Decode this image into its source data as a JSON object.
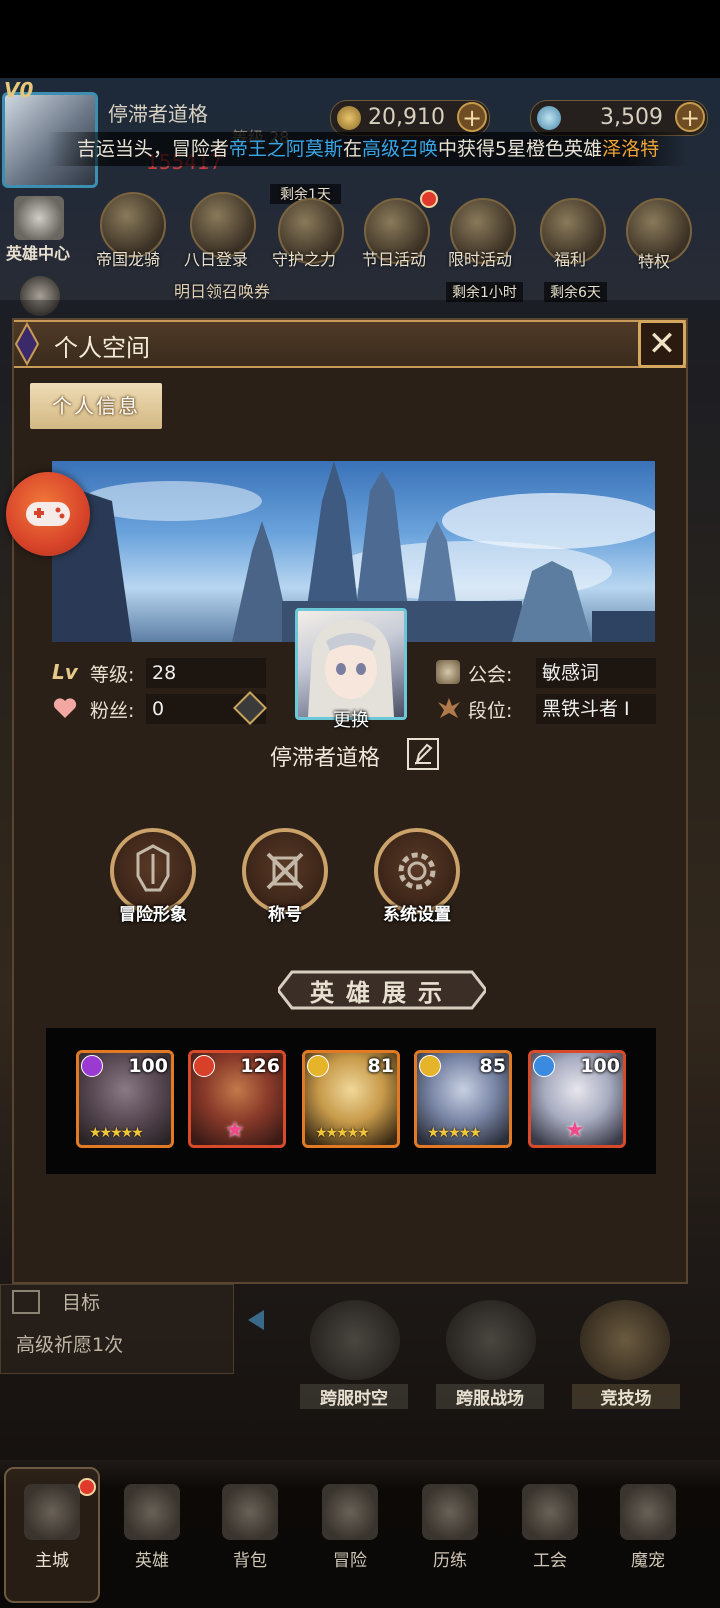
{
  "top_bar": {
    "vip_label": "V0",
    "player_name": "停滞者道格",
    "level_text": "等级 28",
    "power_text": "155417",
    "gold": "20,910",
    "gems": "3,509",
    "add_symbol": "+"
  },
  "broadcast": {
    "prefix": "吉运当头，冒险者",
    "player": "帝王之阿莫斯",
    "mid1": "在",
    "event": "高级召唤",
    "mid2": "中获得5星橙色英雄",
    "hero": "泽洛特"
  },
  "side_left": {
    "hero_center": "英雄中心"
  },
  "top_icons": [
    {
      "label": "帝国龙骑"
    },
    {
      "label": "八日登录",
      "sub": "明日领召唤券"
    },
    {
      "label": "守护之力",
      "timer": "剩余1天"
    },
    {
      "label": "节日活动"
    },
    {
      "label": "限时活动",
      "timer": "剩余1小时"
    },
    {
      "label": "福利",
      "timer": "剩余6天"
    },
    {
      "label": "特权"
    }
  ],
  "panel": {
    "title": "个人空间",
    "close_symbol": "✕",
    "tab": "个人信息",
    "level_label": "等级:",
    "level_value": "28",
    "fans_label": "粉丝:",
    "fans_value": "0",
    "guild_label": "公会:",
    "guild_value": "敏感词",
    "rank_label": "段位:",
    "rank_value": "黑铁斗者 I",
    "change_label": "更换",
    "player_name": "停滞者道格",
    "lv_icon_text": "Lv",
    "actions": [
      {
        "label": "冒险形象"
      },
      {
        "label": "称号"
      },
      {
        "label": "系统设置"
      }
    ],
    "showcase_title": "英雄展示",
    "heroes": [
      {
        "level": "100",
        "element_color": "#9a3ad0",
        "stars": "★★★★★",
        "pink": false,
        "frame": "#e27a23"
      },
      {
        "level": "126",
        "element_color": "#d8402a",
        "stars": "",
        "pink": true,
        "frame": "#d84a2a"
      },
      {
        "level": "81",
        "element_color": "#e6b42a",
        "stars": "★★★★★",
        "pink": false,
        "frame": "#e27a23"
      },
      {
        "level": "85",
        "element_color": "#e6b42a",
        "stars": "★★★★★",
        "pink": false,
        "frame": "#e27a23"
      },
      {
        "level": "100",
        "element_color": "#3a8ae0",
        "stars": "",
        "pink": true,
        "frame": "#d84a2a"
      }
    ]
  },
  "goal": {
    "title": "目标",
    "desc": "高级祈愿1次"
  },
  "features": [
    {
      "label": "跨服时空"
    },
    {
      "label": "跨服战场"
    },
    {
      "label": "竞技场"
    }
  ],
  "nav": [
    {
      "label": "主城"
    },
    {
      "label": "英雄"
    },
    {
      "label": "背包"
    },
    {
      "label": "冒险"
    },
    {
      "label": "历练"
    },
    {
      "label": "工会"
    },
    {
      "label": "魔宠"
    }
  ]
}
